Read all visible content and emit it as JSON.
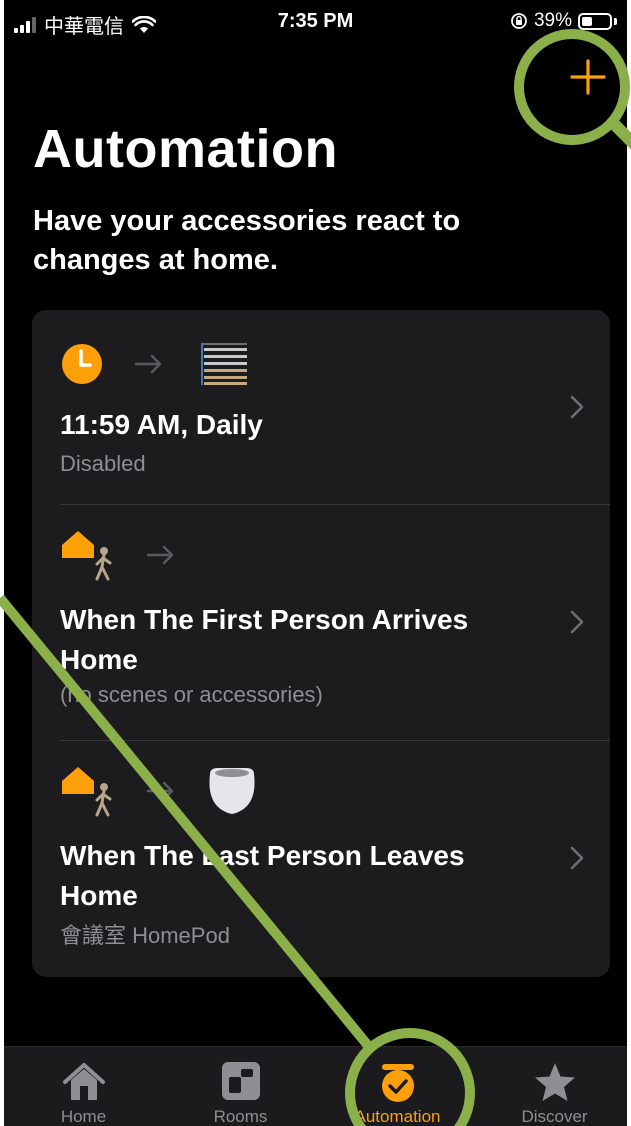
{
  "status_bar": {
    "carrier": "中華電信",
    "time": "7:35 PM",
    "battery": "39%",
    "battery_level": 0.39
  },
  "toolbar": {
    "add_icon": "plus-icon"
  },
  "header": {
    "title": "Automation",
    "subtitle": "Have your accessories react to changes at home."
  },
  "automations": [
    {
      "title": "11:59 AM, Daily",
      "subtitle": "Disabled",
      "trigger_icon": "clock-icon",
      "target_icon": "blinds-icon"
    },
    {
      "title": "When The First Person Arrives Home",
      "subtitle": "(no scenes or accessories)",
      "trigger_icon": "person-arrives-home-icon"
    },
    {
      "title": "When The Last Person Leaves Home",
      "subtitle": "會議室 HomePod",
      "trigger_icon": "person-leaves-home-icon",
      "target_icon": "homepod-mini-icon"
    }
  ],
  "tabs": [
    {
      "label": "Home",
      "icon": "house-icon"
    },
    {
      "label": "Rooms",
      "icon": "rooms-icon"
    },
    {
      "label": "Automation",
      "icon": "automation-clock-icon",
      "active": true
    },
    {
      "label": "Discover",
      "icon": "star-icon"
    }
  ],
  "colors": {
    "accent": "#ff9f0a",
    "background": "#000000",
    "card": "#1c1c1e",
    "secondary_text": "#8e8e93",
    "annotation": "#8bb04a"
  }
}
